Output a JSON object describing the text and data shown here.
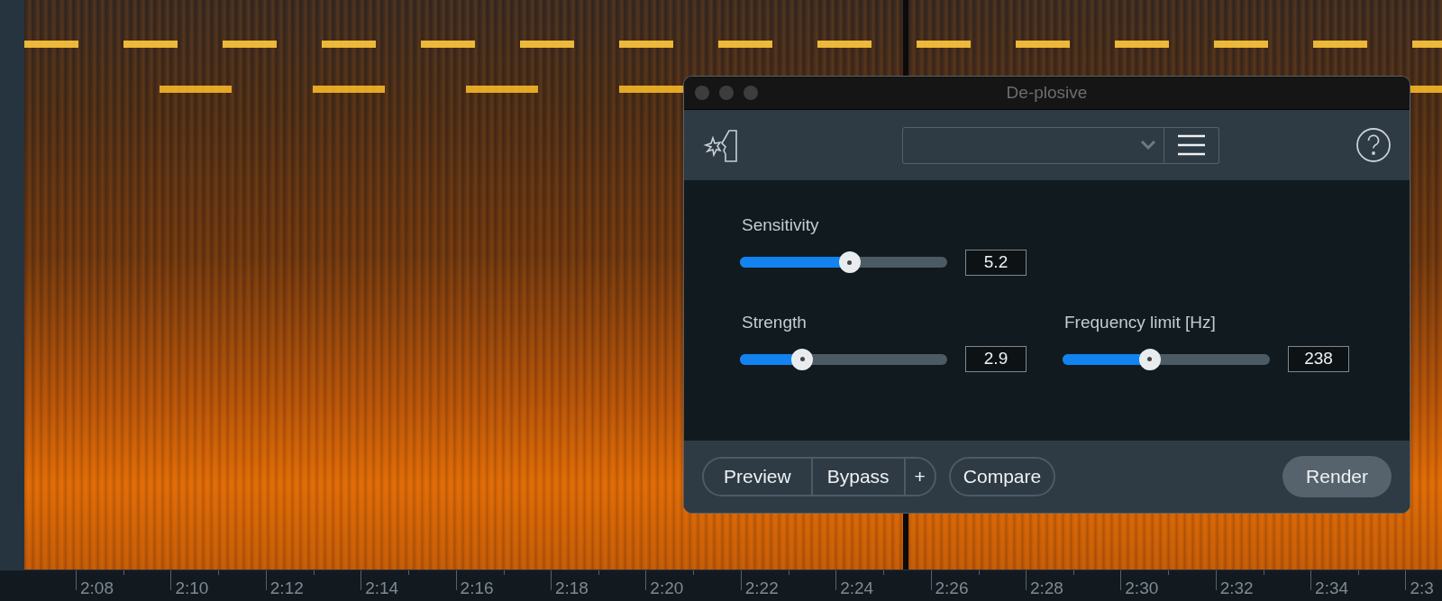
{
  "window": {
    "title": "De-plosive"
  },
  "sliders": [
    {
      "label": "Sensitivity",
      "level": 0.53,
      "reading": "5.2"
    },
    {
      "label": "Strength",
      "level": 0.3,
      "reading": "2.9"
    },
    {
      "label": "Frequency limit [Hz]",
      "level": 0.42,
      "reading": "238"
    }
  ],
  "footer": {
    "group": [
      "Preview",
      "Bypass",
      "+"
    ],
    "compare": "Compare",
    "render": "Render"
  },
  "timeline": [
    "2:08",
    "2:10",
    "2:12",
    "2:14",
    "2:16",
    "2:18",
    "2:20",
    "2:22",
    "2:24",
    "2:26",
    "2:28",
    "2:30",
    "2:32",
    "2:34",
    "2:3"
  ]
}
